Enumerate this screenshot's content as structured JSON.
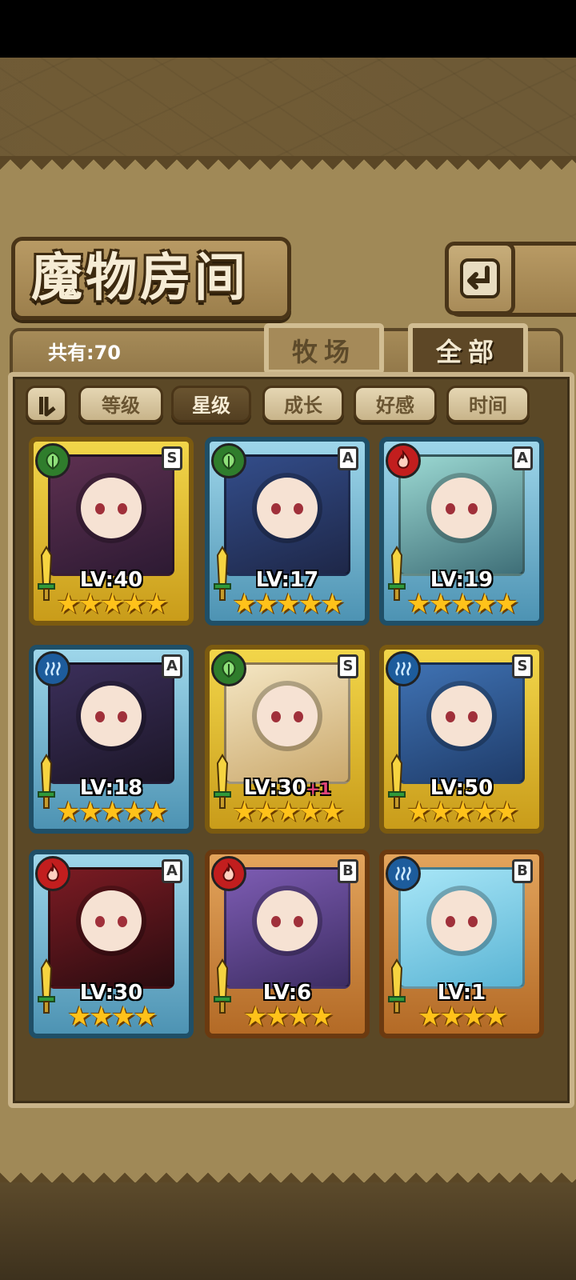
{
  "title": "魔物房间",
  "total_count": "共有:70",
  "tabs": {
    "ranch": "牧场",
    "all": "全部"
  },
  "sort": {
    "toggle_icon": "sort-order-icon",
    "buttons": [
      "等级",
      "星级",
      "成长",
      "好感",
      "时间"
    ],
    "active": "星级"
  },
  "monsters": [
    {
      "level": "LV:40",
      "bonus": "",
      "rank": "S",
      "element": "wood",
      "stars": "★★★★★",
      "frame": "gold"
    },
    {
      "level": "LV:17",
      "bonus": "",
      "rank": "A",
      "element": "wood",
      "stars": "★★★★★",
      "frame": "blue"
    },
    {
      "level": "LV:19",
      "bonus": "",
      "rank": "A",
      "element": "fire",
      "stars": "★★★★★",
      "frame": "blue"
    },
    {
      "level": "LV:18",
      "bonus": "",
      "rank": "A",
      "element": "water",
      "stars": "★★★★★",
      "frame": "blue"
    },
    {
      "level": "LV:30",
      "bonus": "+1",
      "rank": "S",
      "element": "wood",
      "stars": "★★★★★",
      "frame": "gold"
    },
    {
      "level": "LV:50",
      "bonus": "",
      "rank": "S",
      "element": "water",
      "stars": "★★★★★",
      "frame": "gold"
    },
    {
      "level": "LV:30",
      "bonus": "",
      "rank": "A",
      "element": "fire",
      "stars": "★★★★",
      "frame": "blue"
    },
    {
      "level": "LV:6",
      "bonus": "",
      "rank": "B",
      "element": "fire",
      "stars": "★★★★",
      "frame": "bronze"
    },
    {
      "level": "LV:1",
      "bonus": "",
      "rank": "B",
      "element": "water",
      "stars": "★★★★",
      "frame": "bronze"
    }
  ]
}
